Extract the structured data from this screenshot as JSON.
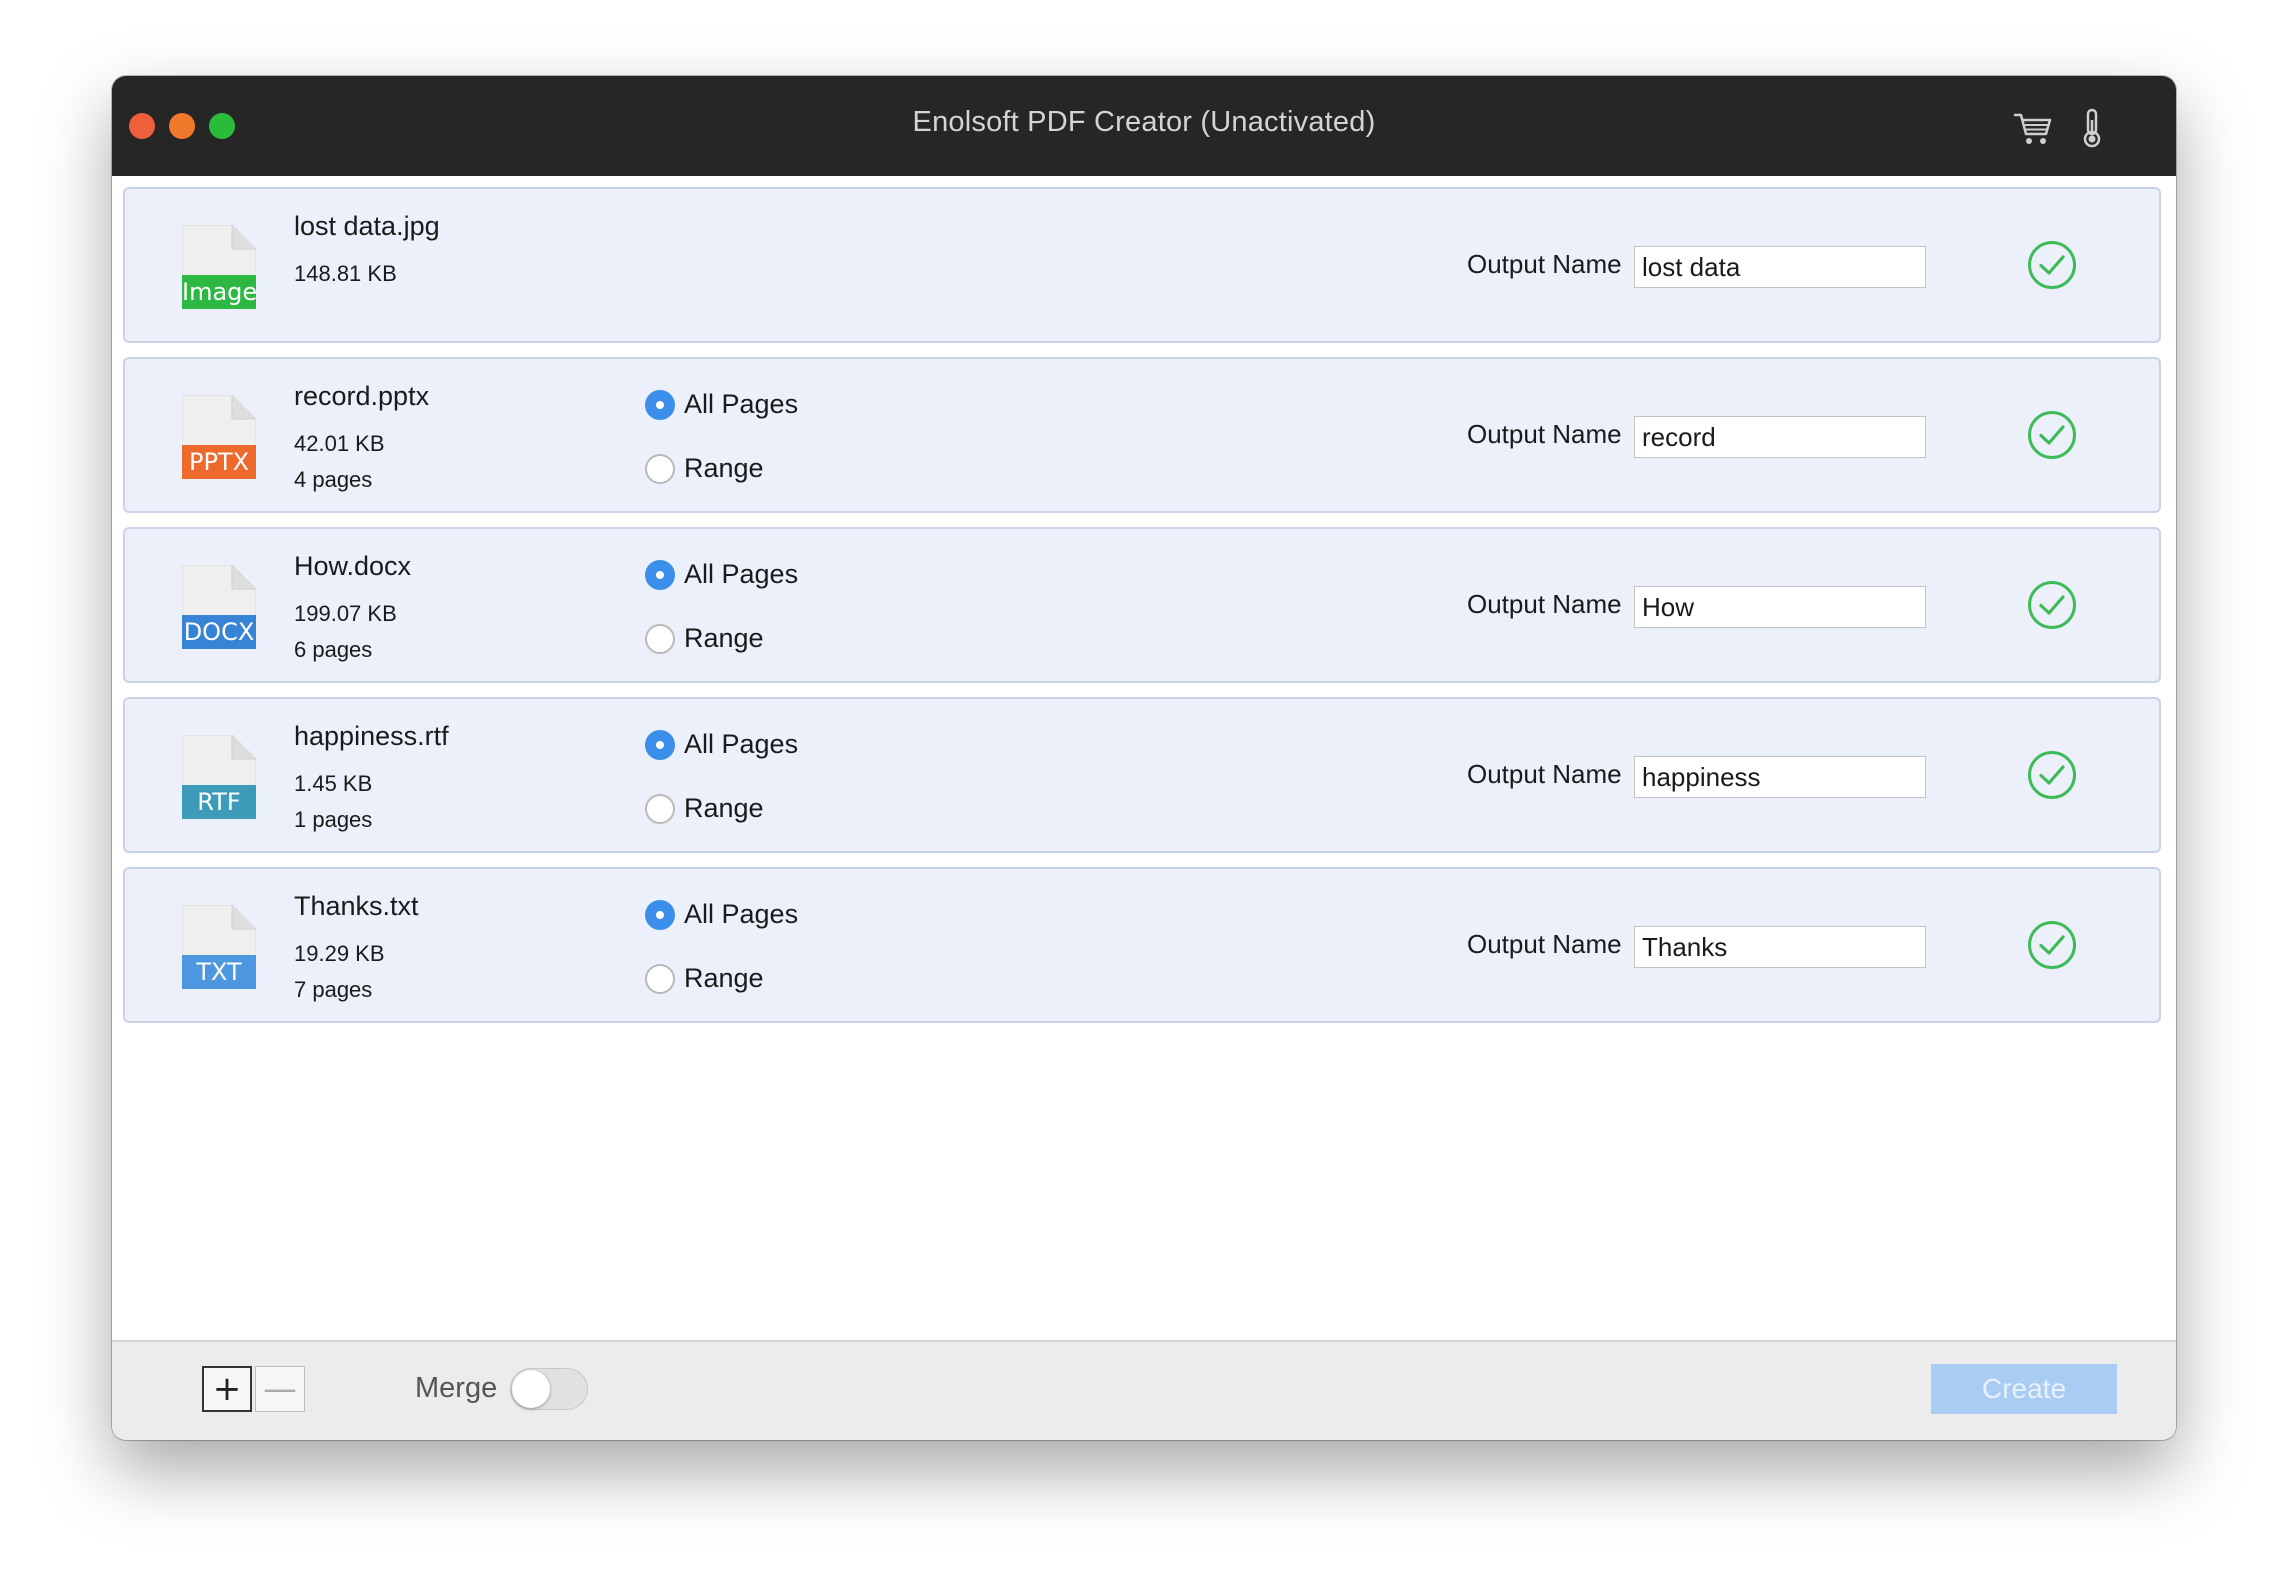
{
  "window": {
    "title": "Enolsoft PDF Creator (Unactivated)"
  },
  "toolbar_icons": [
    "cart-icon",
    "thermometer-icon"
  ],
  "files": [
    {
      "name": "lost data.jpg",
      "size": "148.81 KB",
      "pages": "",
      "type_badge": "Image",
      "badge_color": "#2db843",
      "has_page_options": false,
      "selected": "all",
      "output_label": "Output Name",
      "output_name": "lost data"
    },
    {
      "name": "record.pptx",
      "size": "42.01 KB",
      "pages": "4 pages",
      "type_badge": "PPTX",
      "badge_color": "#ee6a2c",
      "has_page_options": true,
      "selected": "all",
      "output_label": "Output Name",
      "output_name": "record"
    },
    {
      "name": "How.docx",
      "size": "199.07 KB",
      "pages": "6 pages",
      "type_badge": "DOCX",
      "badge_color": "#3783d6",
      "has_page_options": true,
      "selected": "all",
      "output_label": "Output Name",
      "output_name": "How"
    },
    {
      "name": "happiness.rtf",
      "size": "1.45 KB",
      "pages": "1 pages",
      "type_badge": "RTF",
      "badge_color": "#3b9bb9",
      "has_page_options": true,
      "selected": "all",
      "output_label": "Output Name",
      "output_name": "happiness"
    },
    {
      "name": "Thanks.txt",
      "size": "19.29 KB",
      "pages": "7 pages",
      "type_badge": "TXT",
      "badge_color": "#4c97e0",
      "has_page_options": true,
      "selected": "all",
      "output_label": "Output Name",
      "output_name": "Thanks"
    }
  ],
  "page_options": {
    "all_label": "All Pages",
    "range_label": "Range"
  },
  "bottom": {
    "add_symbol": "+",
    "remove_symbol": "—",
    "merge_label": "Merge",
    "merge_on": false,
    "create_label": "Create"
  },
  "colors": {
    "accent": "#3b8ee9",
    "check": "#3dbb56",
    "row_bg": "#ebf0fa"
  }
}
